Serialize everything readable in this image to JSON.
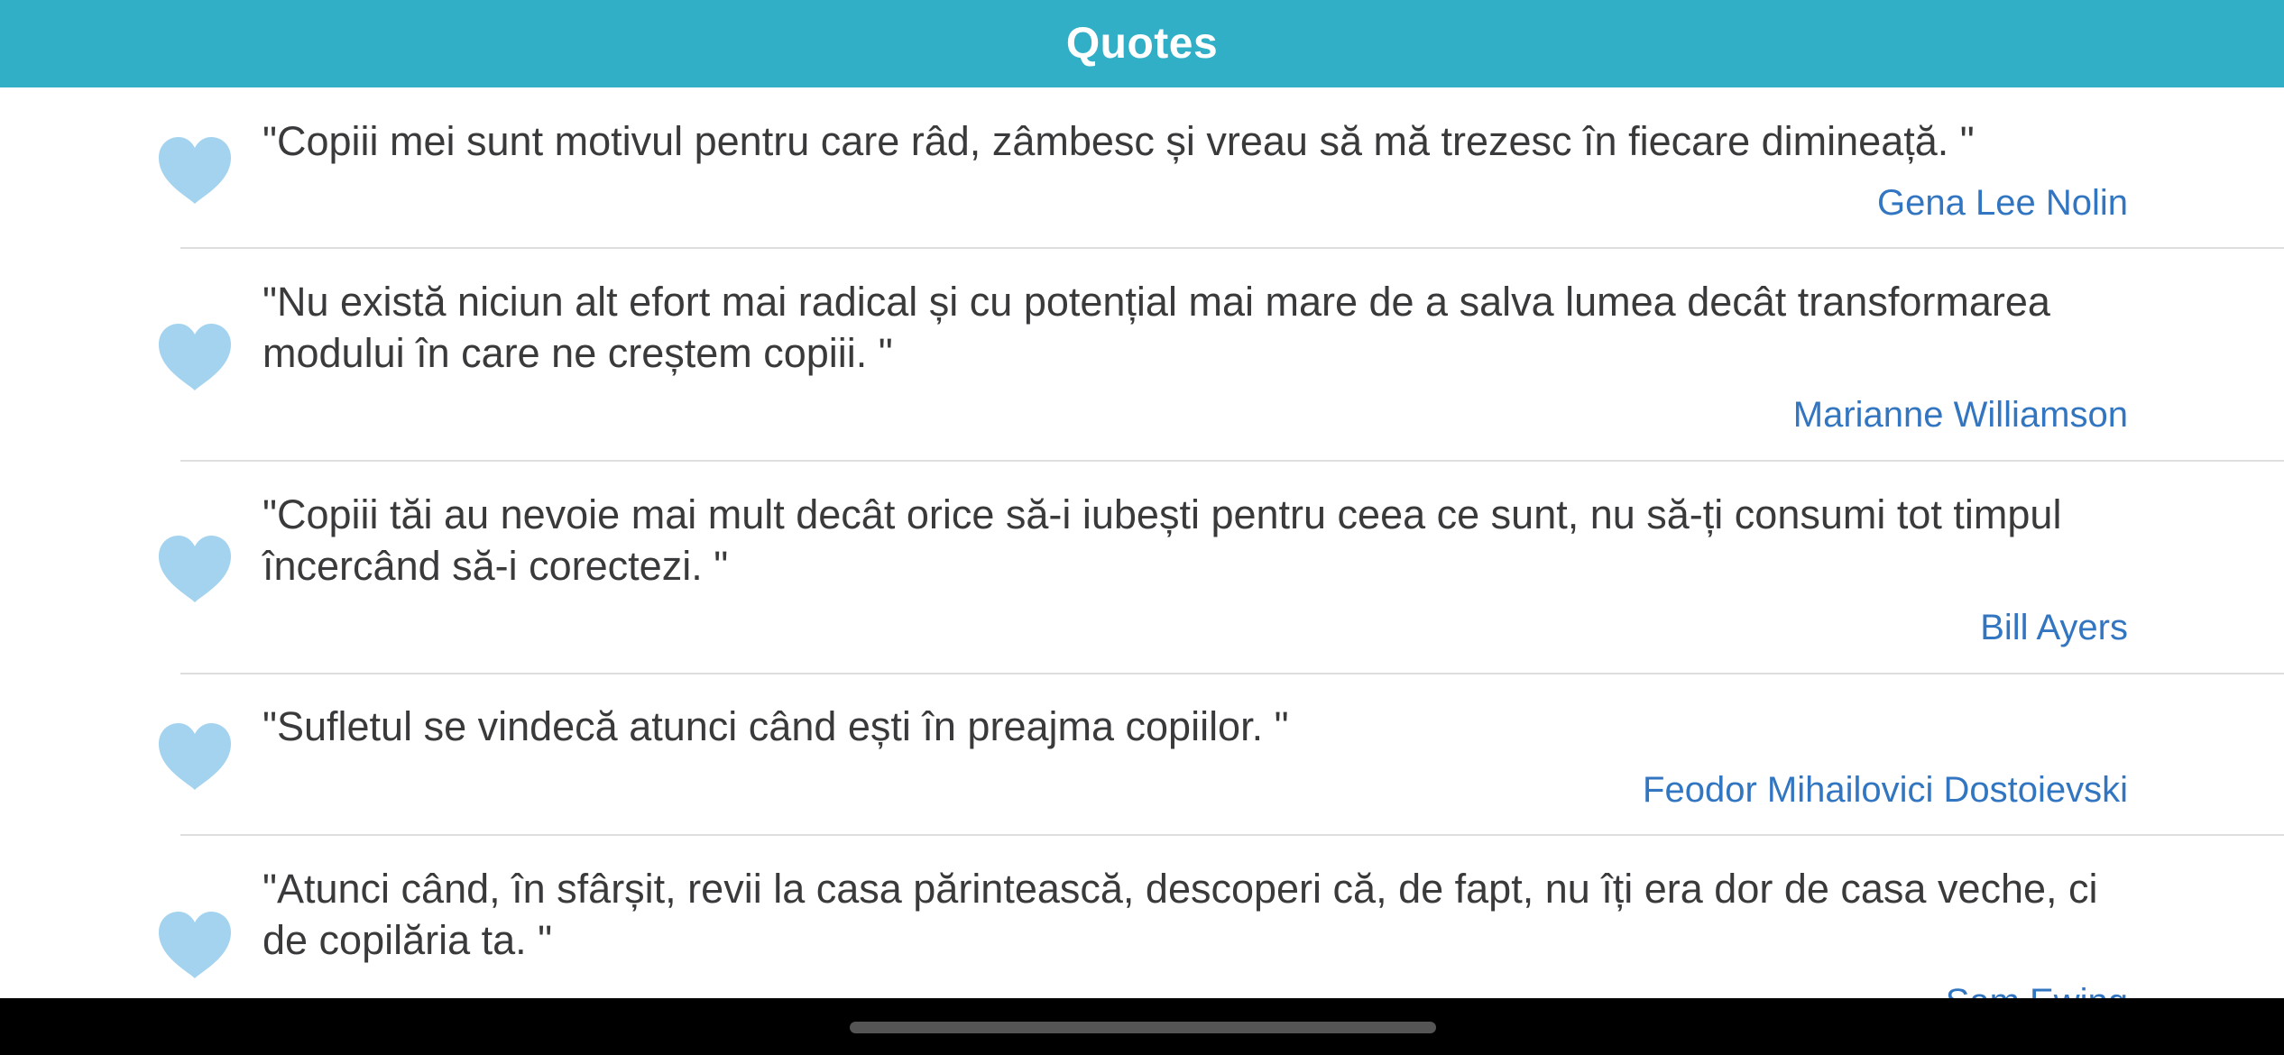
{
  "nav": {
    "title": "Quotes"
  },
  "colors": {
    "nav_background": "#31afc7",
    "heart": "#a4d3f0",
    "author": "#3275c0",
    "quote_text": "#3a3a3c"
  },
  "quotes": [
    {
      "text": "\"Copiii mei sunt motivul pentru care râd, zâmbesc și vreau să mă trezesc în fiecare dimineață. \"",
      "author": "Gena Lee Nolin",
      "icon": "heart-icon"
    },
    {
      "text": "\"Nu există niciun alt efort mai radical și cu potențial mai mare de a salva lumea decât transformarea modului în care ne creștem copiii. \"",
      "author": "Marianne Williamson",
      "icon": "heart-icon"
    },
    {
      "text": "\"Copiii tăi au nevoie mai mult decât orice să-i iubești pentru ceea ce sunt, nu să-ți consumi tot timpul încercând să-i corectezi. \"",
      "author": "Bill Ayers",
      "icon": "heart-icon"
    },
    {
      "text": "\"Sufletul se vindecă atunci când ești în preajma copiilor. \"",
      "author": "Feodor Mihailovici Dostoievski",
      "icon": "heart-icon"
    },
    {
      "text": "\"Atunci când, în sfârșit, revii la casa părintească, descoperi că, de fapt, nu îți era dor de casa veche, ci de copilăria ta. \"",
      "author": "Sam Ewing",
      "icon": "heart-icon"
    }
  ]
}
